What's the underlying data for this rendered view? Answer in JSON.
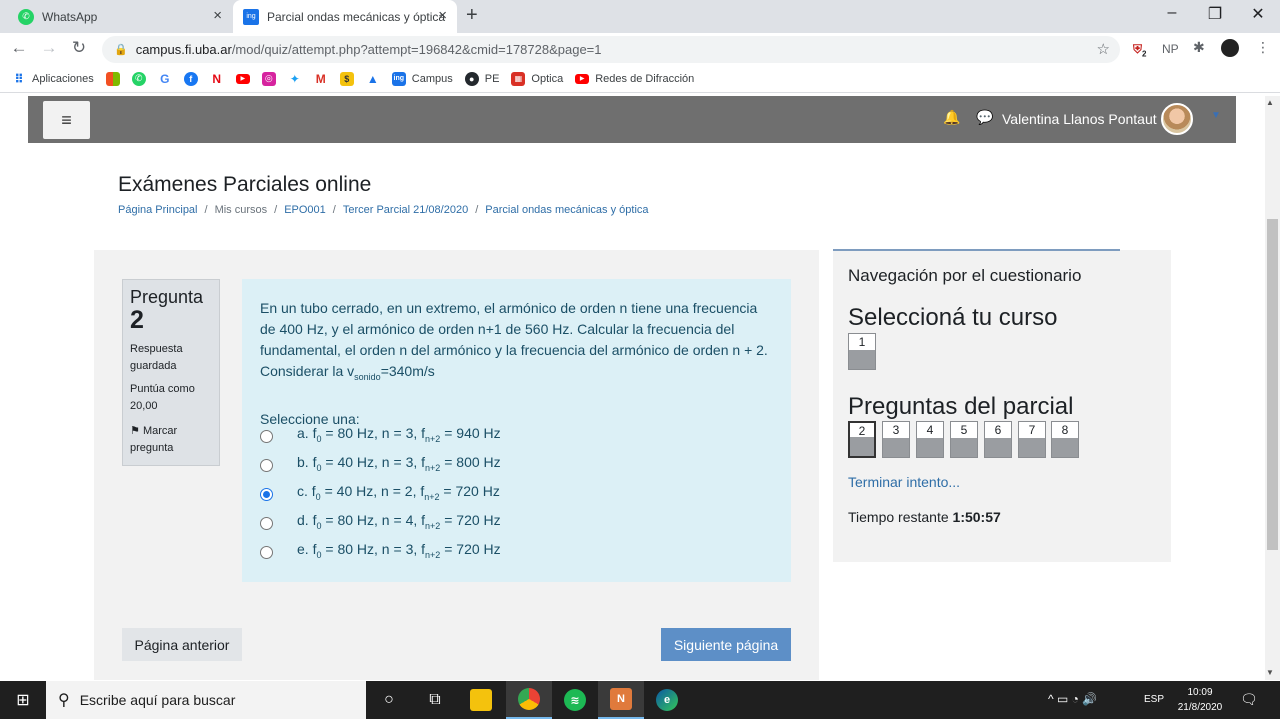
{
  "browser": {
    "tabs": [
      {
        "label": "WhatsApp",
        "icon": "whatsapp-icon",
        "active": false
      },
      {
        "label": "Parcial ondas mecánicas y óptica",
        "icon": "campus-ing-icon",
        "active": true
      }
    ],
    "new_tab": "+",
    "window_controls": [
      "–",
      "❐",
      "✕"
    ],
    "url_host": "campus.fi.uba.ar",
    "url_path": "/mod/quiz/attempt.php?attempt=196842&cmid=178728&page=1",
    "extension_badge": "2",
    "extension_label": "NP"
  },
  "bookmarks": {
    "apps_label": "Aplicaciones",
    "items": [
      {
        "label": "",
        "icon": "microsoft-icon",
        "color": "#f25022"
      },
      {
        "label": "",
        "icon": "whatsapp-icon",
        "color": "#25d366"
      },
      {
        "label": "",
        "icon": "google-icon",
        "color": "#4285f4"
      },
      {
        "label": "",
        "icon": "facebook-icon",
        "color": "#1877f2"
      },
      {
        "label": "",
        "icon": "netflix-icon",
        "color": "#e50914"
      },
      {
        "label": "",
        "icon": "youtube-icon",
        "color": "#ff0000"
      },
      {
        "label": "",
        "icon": "instagram-icon",
        "color": "#d6249f"
      },
      {
        "label": "",
        "icon": "twitter-icon",
        "color": "#1da1f2"
      },
      {
        "label": "",
        "icon": "gmail-icon",
        "color": "#d93025"
      },
      {
        "label": "",
        "icon": "sheets-icon",
        "color": "#f4c20d"
      },
      {
        "label": "",
        "icon": "drive-icon",
        "color": "#1a73e8"
      },
      {
        "label": "Campus",
        "icon": "campus-ing-icon",
        "color": "#1a73e8"
      },
      {
        "label": "PE",
        "icon": "github-icon",
        "color": "#24292e"
      },
      {
        "label": "Optica",
        "icon": "calendar-icon",
        "color": "#d93025"
      },
      {
        "label": "Redes de Difracción",
        "icon": "youtube-icon",
        "color": "#ff0000"
      }
    ]
  },
  "navbar": {
    "menu_icon": "≡",
    "user_name": "Valentina Llanos Pontaut"
  },
  "header": {
    "title": "Exámenes Parciales online",
    "breadcrumb": [
      "Página Principal",
      "Mis cursos",
      "EPO001",
      "Tercer Parcial 21/08/2020",
      "Parcial ondas mecánicas y óptica"
    ]
  },
  "question": {
    "label": "Pregunta",
    "number": "2",
    "state": "Respuesta guardada",
    "grade": "Puntúa como 20,00",
    "flag": "Marcar pregunta",
    "text_main": "En un tubo cerrado, en un extremo, el armónico de orden n tiene una frecuencia de 400 Hz, y el armónico de orden n+1 de 560 Hz. Calcular la frecuencia del fundamental, el orden n del armónico y la frecuencia del armónico de orden n + 2. Considerar la v",
    "text_sub": "sonido",
    "text_end": "=340m/s",
    "prompt": "Seleccione una:",
    "answers": [
      {
        "letter": "a.",
        "f0": "80 Hz",
        "n": "3",
        "fn2": "940 Hz",
        "checked": false
      },
      {
        "letter": "b.",
        "f0": "40 Hz",
        "n": "3",
        "fn2": "800 Hz",
        "checked": false
      },
      {
        "letter": "c.",
        "f0": "40 Hz",
        "n": "2",
        "fn2": "720 Hz",
        "checked": true
      },
      {
        "letter": "d.",
        "f0": "80 Hz",
        "n": "4",
        "fn2": "720 Hz",
        "checked": false
      },
      {
        "letter": "e.",
        "f0": "80 Hz",
        "n": "3",
        "fn2": "720 Hz",
        "checked": false
      }
    ]
  },
  "buttons": {
    "prev": "Página anterior",
    "next": "Siguiente página"
  },
  "quiz_nav": {
    "title": "Navegación por el cuestionario",
    "section1": "Seleccioná tu curso",
    "section1_buttons": [
      "1"
    ],
    "section2": "Preguntas del parcial",
    "section2_buttons": [
      "2",
      "3",
      "4",
      "5",
      "6",
      "7",
      "8"
    ],
    "current": "2",
    "finish": "Terminar intento...",
    "time_label": "Tiempo restante",
    "time_value": "1:50:57"
  },
  "taskbar": {
    "search_placeholder": "Escribe aquí para buscar",
    "lang": "ESP",
    "time": "10:09",
    "date": "21/8/2020"
  }
}
